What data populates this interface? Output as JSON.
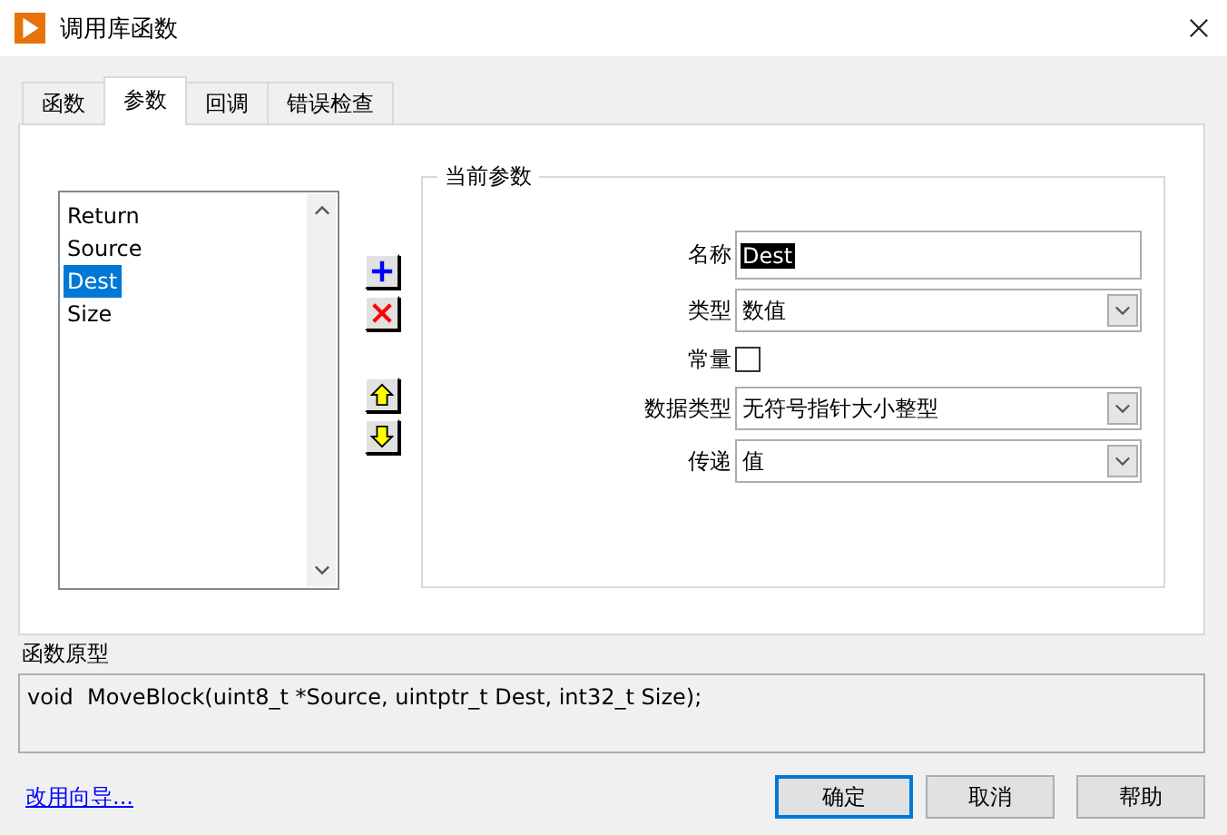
{
  "window": {
    "title": "调用库函数"
  },
  "tabs": [
    {
      "label": "函数",
      "selected": false
    },
    {
      "label": "参数",
      "selected": true
    },
    {
      "label": "回调",
      "selected": false
    },
    {
      "label": "错误检查",
      "selected": false
    }
  ],
  "parameters": {
    "items": [
      {
        "label": "Return",
        "selected": false
      },
      {
        "label": "Source",
        "selected": false
      },
      {
        "label": "Dest",
        "selected": true
      },
      {
        "label": "Size",
        "selected": false
      }
    ]
  },
  "current_parameter": {
    "title": "当前参数",
    "fields": [
      {
        "kind": "text",
        "label": "名称",
        "value": "Dest",
        "text_selected": true
      },
      {
        "kind": "dropdown",
        "label": "类型",
        "value": "数值"
      },
      {
        "kind": "checkbox",
        "label": "常量",
        "checked": false
      },
      {
        "kind": "dropdown",
        "label": "数据类型",
        "value": "无符号指针大小整型"
      },
      {
        "kind": "dropdown",
        "label": "传递",
        "value": "值"
      }
    ]
  },
  "prototype": {
    "label": "函数原型",
    "text": "void  MoveBlock(uint8_t *Source, uintptr_t Dest, int32_t Size);"
  },
  "link": "改用向导...",
  "buttons": [
    {
      "label": "确定",
      "default": true
    },
    {
      "label": "取消",
      "default": false
    },
    {
      "label": "帮助",
      "default": false
    }
  ]
}
